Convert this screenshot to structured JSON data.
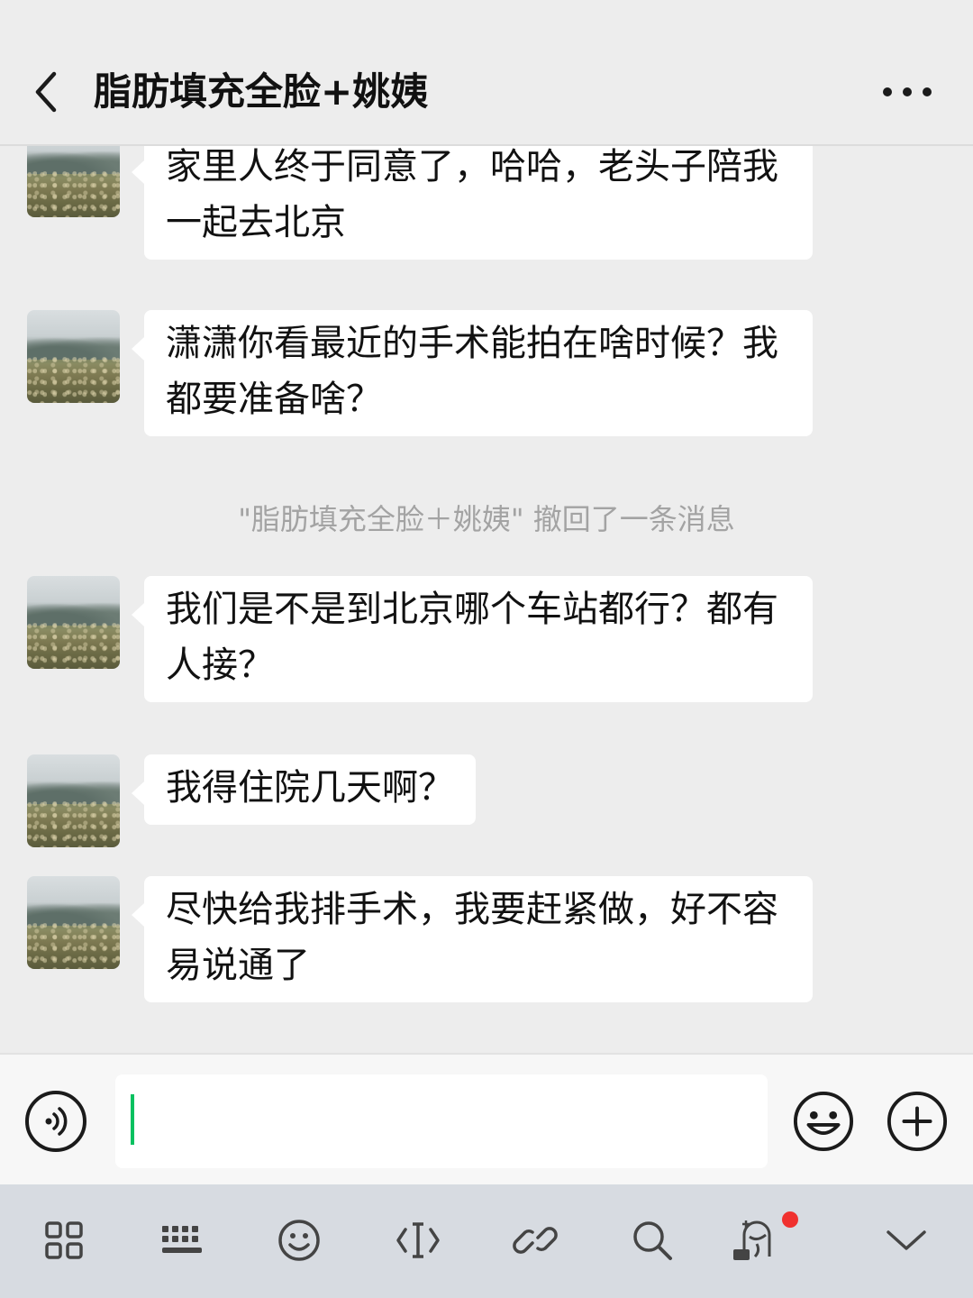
{
  "header": {
    "back_icon": "chevron-left-icon",
    "title": "脂肪填充全脸+姚姨",
    "more_icon": "more-dots-icon"
  },
  "messages": [
    {
      "sender": "contact",
      "text": "家里人终于同意了，哈哈，老头子陪我一起去北京"
    },
    {
      "sender": "contact",
      "text": "潇潇你看最近的手术能拍在啥时候？我都要准备啥？"
    },
    {
      "sender": "system",
      "text": "\"脂肪填充全脸＋姚姨\" 撤回了一条消息"
    },
    {
      "sender": "contact",
      "text": "我们是不是到北京哪个车站都行？都有人接？"
    },
    {
      "sender": "contact",
      "text": "我得住院几天啊？"
    },
    {
      "sender": "contact",
      "text": "尽快给我排手术，我要赶紧做，好不容易说通了"
    }
  ],
  "input_bar": {
    "voice_icon": "voice-icon",
    "input_value": "",
    "emoji_icon": "emoji-icon",
    "plus_icon": "plus-icon",
    "accent_color": "#07c160"
  },
  "keyboard_toolbar": {
    "items": [
      "apps-grid-icon",
      "keyboard-icon",
      "smiley-icon",
      "text-cursor-icon",
      "link-icon",
      "search-icon",
      "ad-avatar-icon",
      "chevron-down-icon"
    ],
    "notification_dot_color": "#f0312f"
  }
}
